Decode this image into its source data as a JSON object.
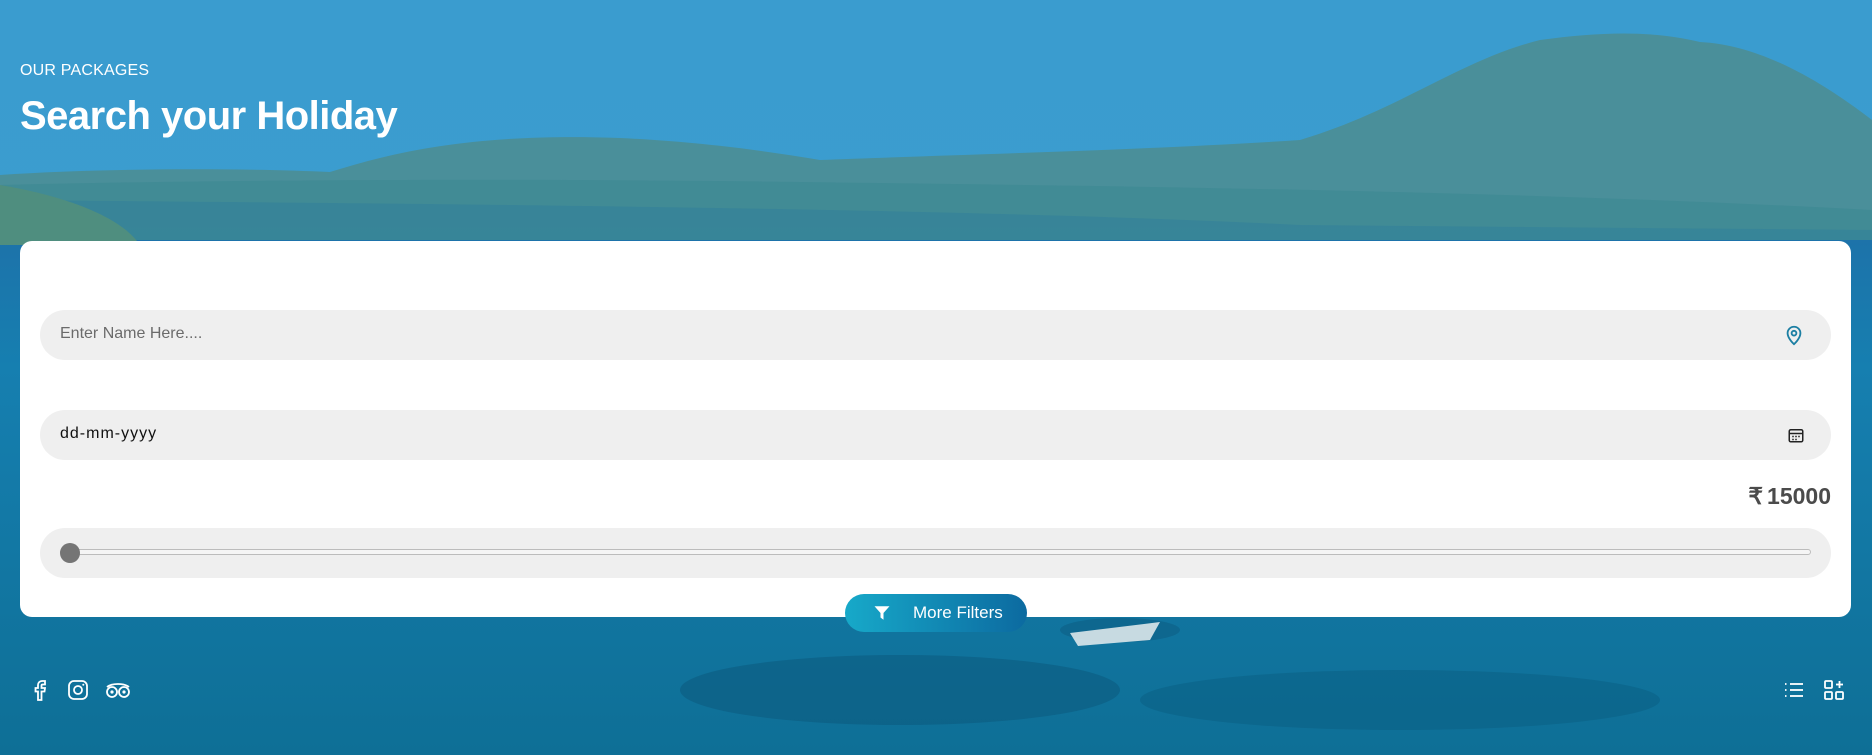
{
  "hero": {
    "eyebrow": "OUR PACKAGES",
    "title": "Search your Holiday"
  },
  "search": {
    "name_placeholder": "Enter Name Here....",
    "date_value": "dd-mm-yyyy",
    "price_symbol": "₹",
    "price_value": "15000",
    "price_slider_fraction": 0.0,
    "more_filters_label": "More Filters"
  },
  "icons": {
    "location": "location-pin-icon",
    "calendar": "calendar-icon",
    "filter": "filter-icon",
    "social": [
      "facebook-icon",
      "instagram-icon",
      "tripadvisor-icon"
    ],
    "views": [
      "list-view-icon",
      "grid-view-icon"
    ]
  },
  "colors": {
    "accent_start": "#17a9c9",
    "accent_end": "#0c6aa0",
    "icon_blue": "#1c7fa3",
    "field_bg": "#efefef"
  }
}
